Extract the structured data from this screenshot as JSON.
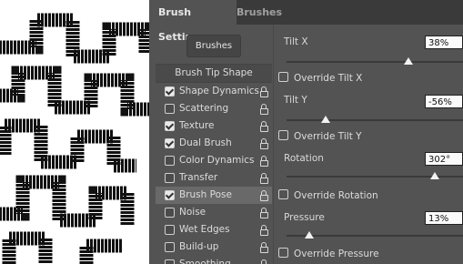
{
  "tabs": {
    "active": "Brush Settings",
    "inactive": "Brushes"
  },
  "brushes_button": "Brushes",
  "options": [
    {
      "label": "Brush Tip Shape",
      "header": true
    },
    {
      "label": "Shape Dynamics",
      "checked": true,
      "lock": true
    },
    {
      "label": "Scattering",
      "checked": false,
      "lock": true
    },
    {
      "label": "Texture",
      "checked": true,
      "lock": true
    },
    {
      "label": "Dual Brush",
      "checked": true,
      "lock": true
    },
    {
      "label": "Color Dynamics",
      "checked": false,
      "lock": true
    },
    {
      "label": "Transfer",
      "checked": false,
      "lock": true
    },
    {
      "label": "Brush Pose",
      "checked": true,
      "lock": true,
      "selected": true
    },
    {
      "label": "Noise",
      "checked": false,
      "lock": true
    },
    {
      "label": "Wet Edges",
      "checked": false,
      "lock": true
    },
    {
      "label": "Build-up",
      "checked": false,
      "lock": true
    },
    {
      "label": "Smoothing",
      "checked": false,
      "lock": true
    }
  ],
  "settings": {
    "tilt_x": {
      "label": "Tilt X",
      "value": "38%",
      "override": "Override Tilt X",
      "slider": 0.69
    },
    "tilt_y": {
      "label": "Tilt Y",
      "value": "-56%",
      "override": "Override Tilt Y",
      "slider": 0.22
    },
    "rotation": {
      "label": "Rotation",
      "value": "302°",
      "override": "Override Rotation",
      "slider": 0.84
    },
    "pressure": {
      "label": "Pressure",
      "value": "13%",
      "override": "Override Pressure",
      "slider": 0.13
    }
  }
}
